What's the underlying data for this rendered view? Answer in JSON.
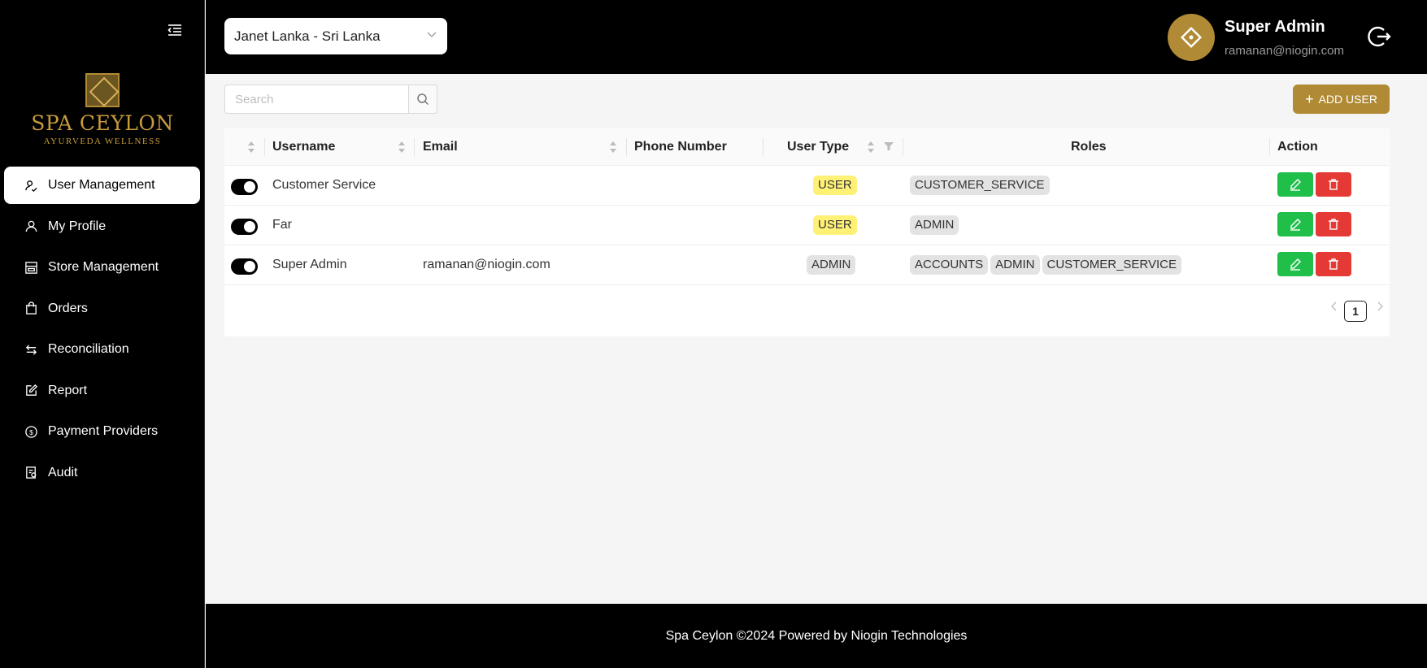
{
  "brand": {
    "title": "SPA CEYLON",
    "subtitle": "AYURVEDA WELLNESS",
    "accent": "#b18a35"
  },
  "sidebar": {
    "items": [
      {
        "label": "User Management",
        "icon": "users-icon",
        "active": true
      },
      {
        "label": "My Profile",
        "icon": "user-icon"
      },
      {
        "label": "Store Management",
        "icon": "store-icon"
      },
      {
        "label": "Orders",
        "icon": "shopping-bag-icon"
      },
      {
        "label": "Reconciliation",
        "icon": "swap-icon"
      },
      {
        "label": "Report",
        "icon": "edit-note-icon"
      },
      {
        "label": "Payment Providers",
        "icon": "dollar-circle-icon"
      },
      {
        "label": "Audit",
        "icon": "audit-icon"
      }
    ]
  },
  "header": {
    "store_selected": "Janet Lanka - Sri Lanka",
    "user_name": "Super Admin",
    "user_email": "ramanan@niogin.com"
  },
  "toolbar": {
    "search_placeholder": "Search",
    "add_user_label": "ADD USER"
  },
  "table": {
    "columns": [
      "Username",
      "Email",
      "Phone Number",
      "User Type",
      "Roles",
      "Action"
    ],
    "rows": [
      {
        "enabled": true,
        "username": "Customer Service",
        "email": "",
        "phone": "",
        "user_type": "USER",
        "roles": [
          "CUSTOMER_SERVICE"
        ]
      },
      {
        "enabled": true,
        "username": "Far",
        "email": "",
        "phone": "",
        "user_type": "USER",
        "roles": [
          "ADMIN"
        ]
      },
      {
        "enabled": true,
        "username": "Super Admin",
        "email": "ramanan@niogin.com",
        "phone": "",
        "user_type": "ADMIN",
        "roles": [
          "ACCOUNTS",
          "ADMIN",
          "CUSTOMER_SERVICE"
        ]
      }
    ]
  },
  "pagination": {
    "current_page": "1"
  },
  "footer": {
    "text": "Spa Ceylon ©2024 Powered by Niogin Technologies"
  }
}
